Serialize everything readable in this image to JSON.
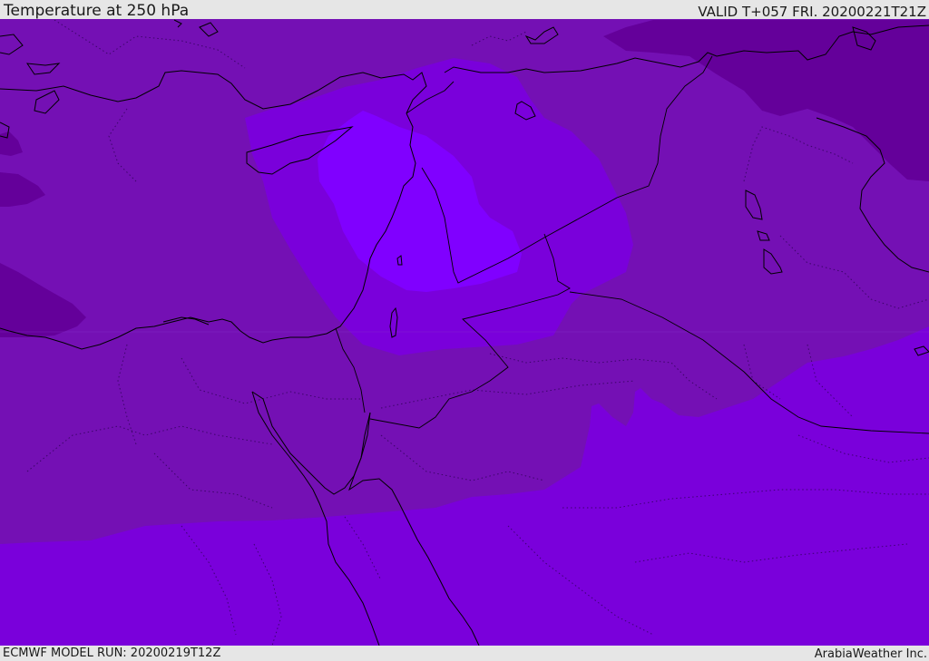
{
  "header": {
    "title": "Temperature at 250 hPa",
    "valid_time": "VALID T+057 FRI. 20200221T21Z"
  },
  "footer": {
    "model_run": "ECMWF MODEL RUN: 20200219T12Z",
    "credit": "ArabiaWeather Inc."
  },
  "map": {
    "field": "temperature",
    "level": "250 hPa",
    "colors": {
      "coldest": "#64009a",
      "cold": "#7410b4",
      "cool": "#7a00db",
      "warm": "#7f00f0",
      "warmest": "#8000ff",
      "coastline": "#000000"
    }
  }
}
